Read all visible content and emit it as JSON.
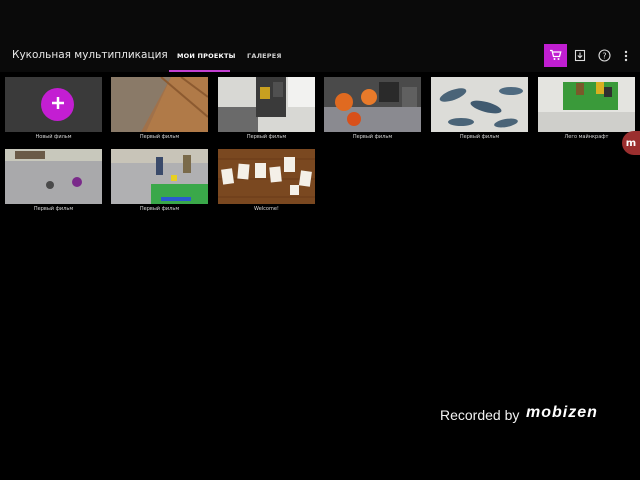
{
  "app": {
    "title": "Кукольная мультипликация"
  },
  "tabs": [
    {
      "label": "МОИ ПРОЕКТЫ",
      "active": true
    },
    {
      "label": "ГАЛЕРЕЯ",
      "active": false
    }
  ],
  "toolbar": {
    "store_icon": "cart-icon",
    "import_icon": "download-icon",
    "help_icon": "help-icon",
    "more_icon": "more-vertical-icon",
    "accent": "#c01ed1"
  },
  "projects": [
    {
      "label": "Новый фильм",
      "kind": "new"
    },
    {
      "label": "Первый фильм",
      "kind": "thumb"
    },
    {
      "label": "Первый фильм",
      "kind": "thumb"
    },
    {
      "label": "Первый фильм",
      "kind": "thumb"
    },
    {
      "label": "Первый фильм",
      "kind": "thumb"
    },
    {
      "label": "Лего майнкрафт",
      "kind": "thumb"
    },
    {
      "label": "Первый фильм",
      "kind": "thumb"
    },
    {
      "label": "Первый фильм",
      "kind": "thumb"
    },
    {
      "label": "Welcome!",
      "kind": "thumb"
    }
  ],
  "watermark": {
    "text": "Recorded by",
    "brand": "mobizen"
  },
  "floating_badge": {
    "letter": "m"
  }
}
